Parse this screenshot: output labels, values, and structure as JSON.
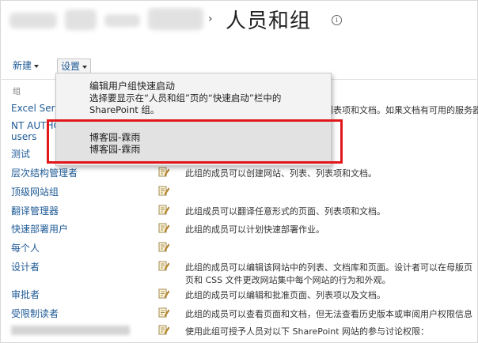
{
  "header": {
    "separator": "›",
    "title": "人员和组",
    "info_icon": "info-icon"
  },
  "toolbar": {
    "new_label": "新建",
    "settings_label": "设置"
  },
  "list": {
    "column_header": "组",
    "rows": [
      {
        "name": "Excel Servic",
        "desc": "此组的成员可以查看网站中的页面、列表项和文档。如果文档有可用的服务器呈现，"
      },
      {
        "name": "NT AUTHO",
        "name2": "users",
        "desc": ""
      },
      {
        "name": "测试",
        "desc": ""
      },
      {
        "name": "层次结构管理者",
        "desc": "此组的成员可以创建网站、列表、列表项和文档。"
      },
      {
        "name": "顶级网站组",
        "desc": ""
      },
      {
        "name": "翻译管理器",
        "desc": "此组成员可以翻译任意形式的页面、列表项和文档。"
      },
      {
        "name": "快速部署用户",
        "desc": "此组的成员可以计划快速部署作业。"
      },
      {
        "name": "每个人",
        "desc": ""
      },
      {
        "name": "设计者",
        "desc": "此组的成员可以编辑该网站中的列表、文档库和页面。设计者可以在母版页",
        "desc2": "页和 CSS 文件更改网站集中每个网站的行为和外观。"
      },
      {
        "name": "审批者",
        "desc": "此组的成员可以编辑和批准页面、列表项以及文档。"
      },
      {
        "name": "受限制读者",
        "desc": "此组的成员可以查看页面和文档，但无法查看历史版本或审阅用户权限信息"
      },
      {
        "name": "",
        "desc": "使用此组可授予人员对以下 SharePoint 网站的参与讨论权限："
      }
    ]
  },
  "menu": {
    "item1_title": "编辑用户组快速启动",
    "item1_desc": "选择要显示在“人员和组”页的“快速启动”栏中的 SharePoint 组。",
    "item2_line1": "博客园-霖雨",
    "item2_line2": "博客园-霖雨"
  },
  "colors": {
    "link": "#1e5a96",
    "highlight": "#e2171b"
  }
}
